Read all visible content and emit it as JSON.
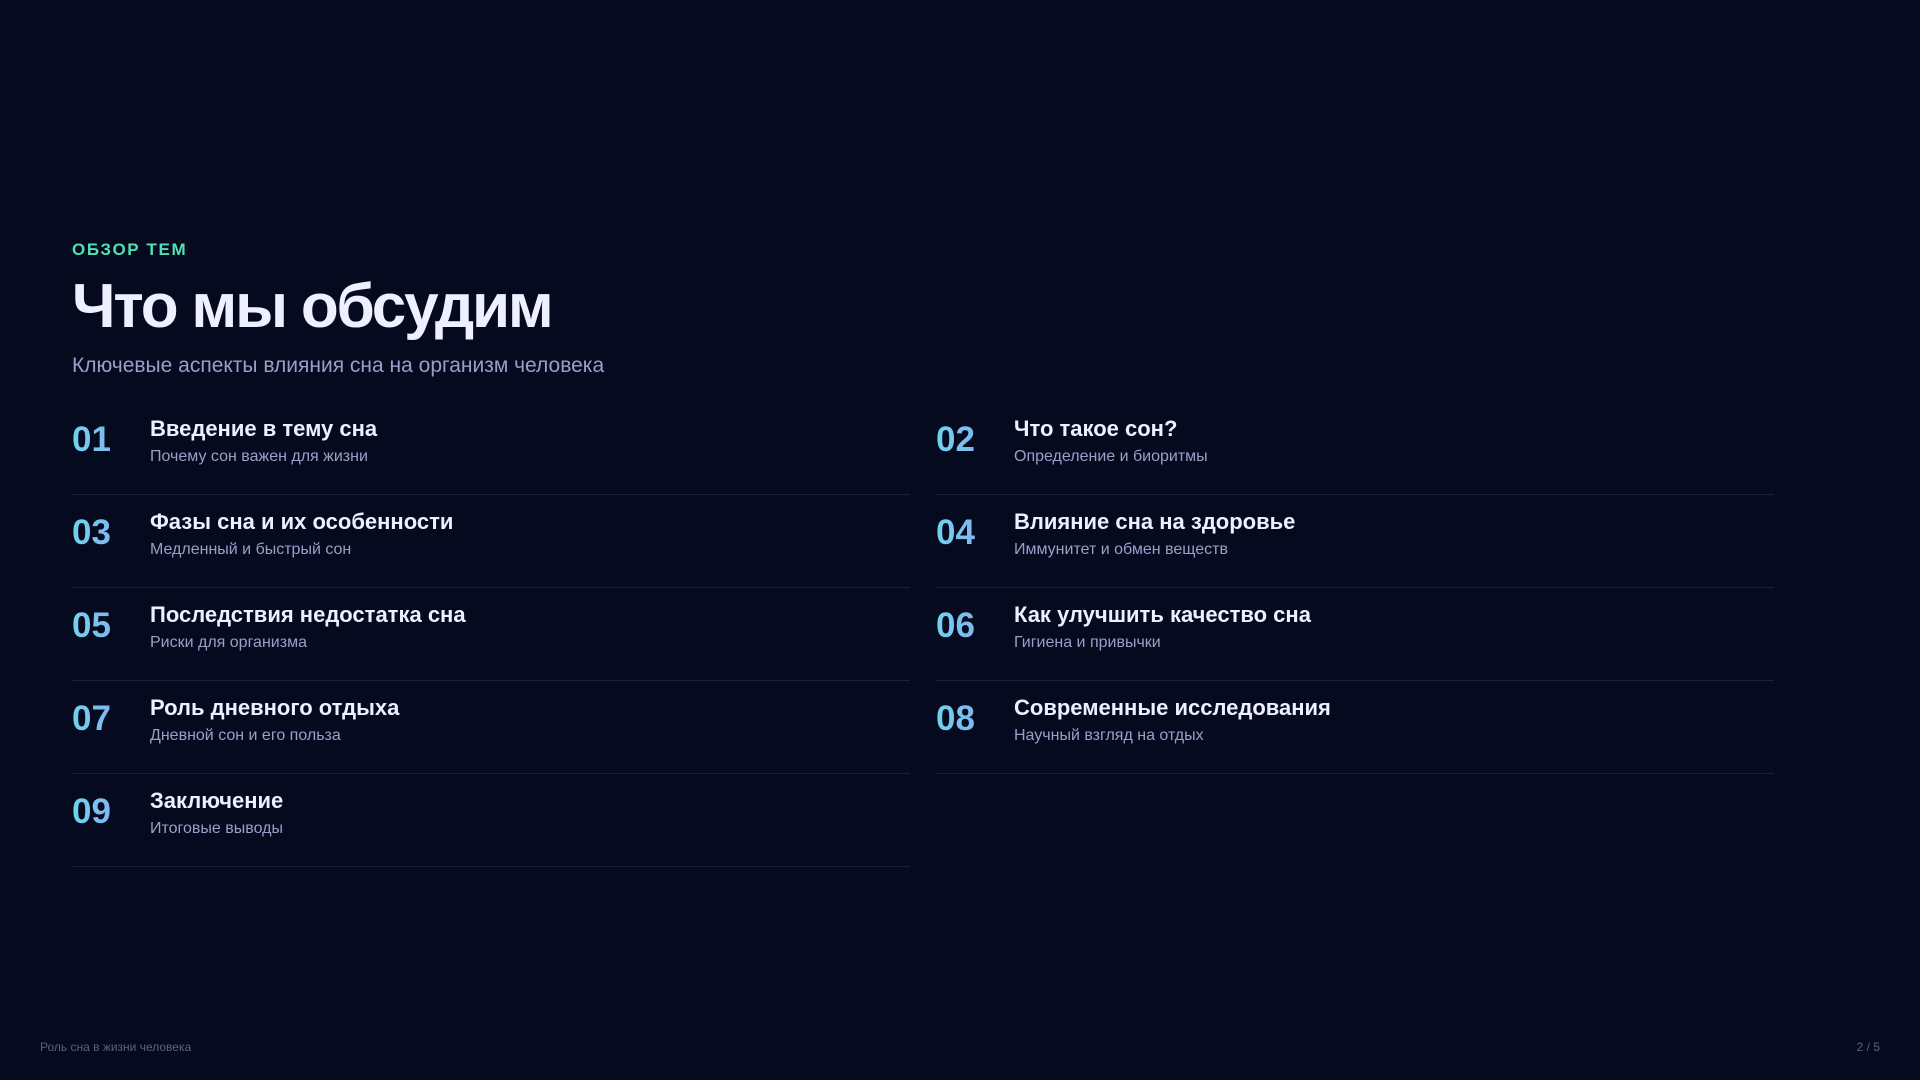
{
  "header": {
    "eyebrow": "ОБЗОР ТЕМ",
    "title": "Что мы обсудим",
    "subtitle": "Ключевые аспекты влияния сна на организм человека"
  },
  "topics": [
    {
      "num": "01",
      "title": "Введение в тему сна",
      "sub": "Почему сон важен для жизни"
    },
    {
      "num": "02",
      "title": "Что такое сон?",
      "sub": "Определение и биоритмы"
    },
    {
      "num": "03",
      "title": "Фазы сна и их особенности",
      "sub": "Медленный и быстрый сон"
    },
    {
      "num": "04",
      "title": "Влияние сна на здоровье",
      "sub": "Иммунитет и обмен веществ"
    },
    {
      "num": "05",
      "title": "Последствия недостатка сна",
      "sub": "Риски для организма"
    },
    {
      "num": "06",
      "title": "Как улучшить качество сна",
      "sub": "Гигиена и привычки"
    },
    {
      "num": "07",
      "title": "Роль дневного отдыха",
      "sub": "Дневной сон и его польза"
    },
    {
      "num": "08",
      "title": "Современные исследования",
      "sub": "Научный взгляд на отдых"
    },
    {
      "num": "09",
      "title": "Заключение",
      "sub": "Итоговые выводы"
    }
  ],
  "footer": {
    "deck_title": "Роль сна в жизни человека",
    "page": "2 / 5"
  },
  "colors": {
    "background": "#060a1e",
    "accent": "#4fe0b4",
    "number_gradient_start": "#6fd3ee",
    "number_gradient_end": "#8e9cf2"
  }
}
